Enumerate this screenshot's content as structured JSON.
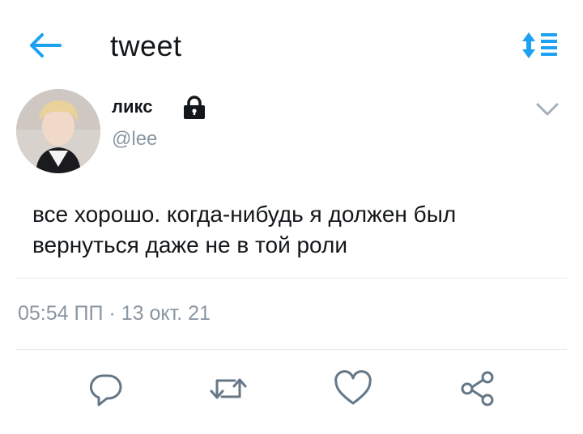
{
  "header": {
    "title": "tweet",
    "back_icon": "arrow-left-icon",
    "sort_icon": "sort-list-icon",
    "accent_color": "#1da1f2"
  },
  "tweet": {
    "author": {
      "display_name": "ликс",
      "handle": "@lee",
      "protected_icon": "lock-icon"
    },
    "text_lines": [
      "все хорошо. когда-нибудь я должен был",
      "вернуться даже не в той роли"
    ],
    "time": "05:54 ПП",
    "separator": "·",
    "date": "13 окт. 21",
    "more_icon": "chevron-down-icon"
  },
  "actions": [
    {
      "name": "reply",
      "icon": "reply-icon"
    },
    {
      "name": "retweet",
      "icon": "retweet-icon"
    },
    {
      "name": "like",
      "icon": "heart-icon"
    },
    {
      "name": "share",
      "icon": "share-icon"
    }
  ],
  "colors": {
    "text_primary": "#14171a",
    "text_secondary": "#8a96a1",
    "divider": "#e1e8ed",
    "icon_gray": "#657786"
  }
}
